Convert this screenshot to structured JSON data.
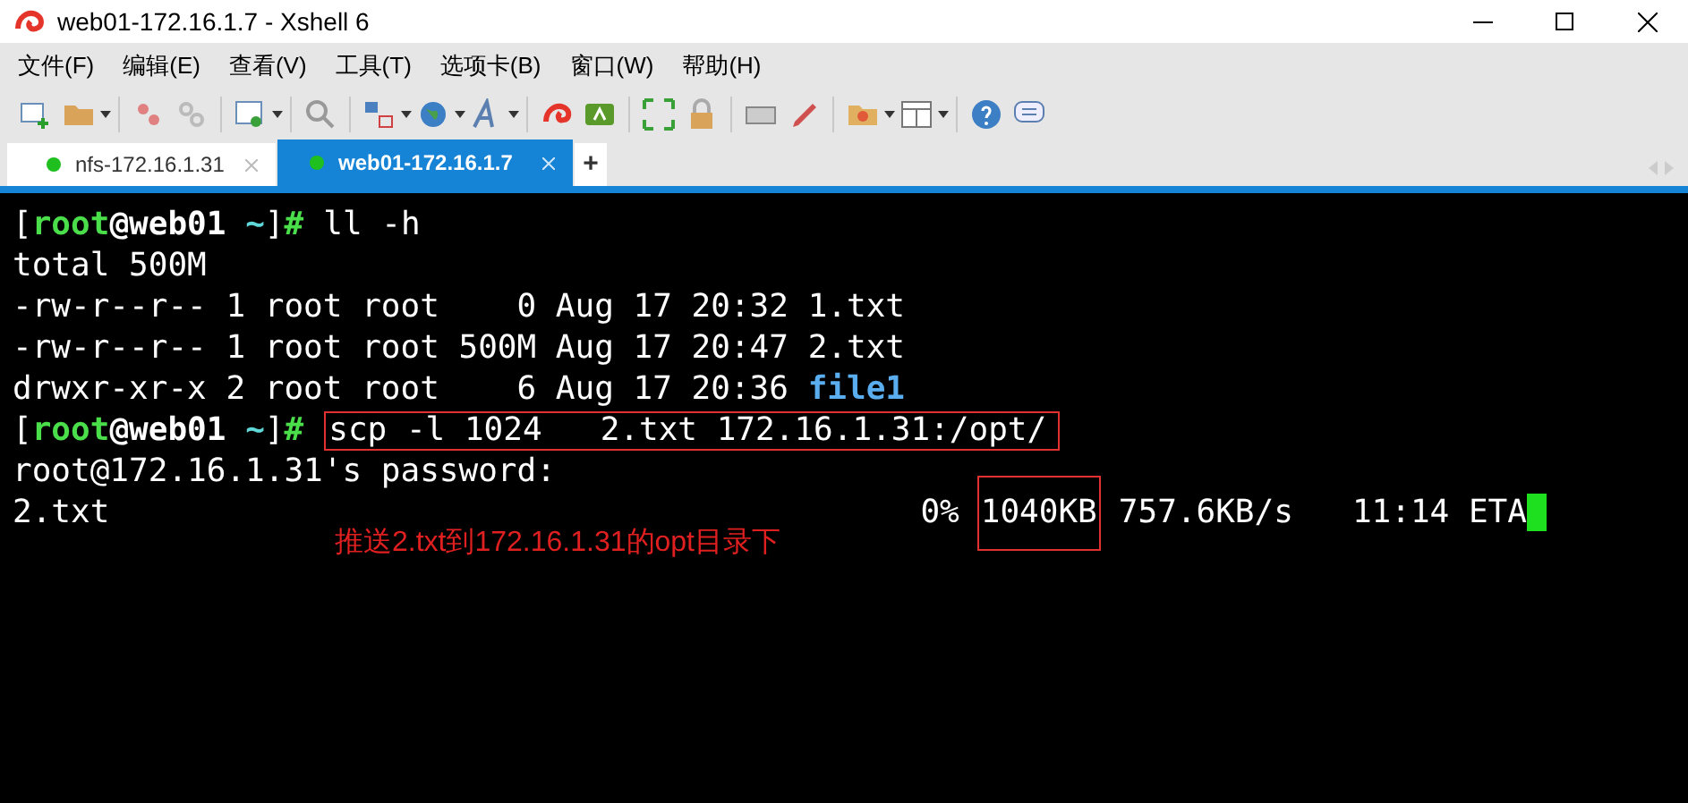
{
  "window": {
    "title": "web01-172.16.1.7 - Xshell 6"
  },
  "menu": [
    "文件(F)",
    "编辑(E)",
    "查看(V)",
    "工具(T)",
    "选项卡(B)",
    "窗口(W)",
    "帮助(H)"
  ],
  "tabs": [
    {
      "label": "nfs-172.16.1.31",
      "selected": false
    },
    {
      "label": "web01-172.16.1.7",
      "selected": true
    }
  ],
  "new_tab": "+",
  "terminal": {
    "lines": [
      {
        "kind": "prompt",
        "parts": [
          {
            "text": "[",
            "kind": "bracket"
          },
          {
            "text": "root",
            "kind": "user"
          },
          {
            "text": "@web01",
            "kind": "host"
          },
          {
            "text": " ~",
            "kind": "dir"
          },
          {
            "text": "]",
            "kind": "bracket"
          },
          {
            "text": "#",
            "kind": "hash"
          }
        ],
        "command": "ll -h",
        "boxed": false
      },
      {
        "kind": "output",
        "parts": [
          {
            "text": "total 500M",
            "kind": "plain"
          }
        ]
      },
      {
        "kind": "output",
        "parts": [
          {
            "text": "-rw-r--r-- 1 root root    0 Aug 17 20:32 ",
            "kind": "plain"
          },
          {
            "text": "1.txt",
            "kind": "plain"
          }
        ]
      },
      {
        "kind": "output",
        "parts": [
          {
            "text": "-rw-r--r-- 1 root root 500M Aug 17 20:47 ",
            "kind": "plain"
          },
          {
            "text": "2.txt",
            "kind": "plain"
          }
        ]
      },
      {
        "kind": "output",
        "parts": [
          {
            "text": "drwxr-xr-x 2 root root    6 Aug 17 20:36 ",
            "kind": "plain"
          },
          {
            "text": "file1",
            "kind": "directory"
          }
        ]
      },
      {
        "kind": "prompt",
        "parts": [
          {
            "text": "[",
            "kind": "bracket"
          },
          {
            "text": "root",
            "kind": "user"
          },
          {
            "text": "@web01",
            "kind": "host"
          },
          {
            "text": " ~",
            "kind": "dir"
          },
          {
            "text": "]",
            "kind": "bracket"
          },
          {
            "text": "#",
            "kind": "hash"
          }
        ],
        "command": "scp -l 1024   2.txt 172.16.1.31:/opt/",
        "boxed": true
      },
      {
        "kind": "output",
        "parts": [
          {
            "text": "root@172.16.1.31's password:",
            "kind": "plain"
          }
        ]
      },
      {
        "kind": "progress",
        "file": "2.txt",
        "percent": "0%",
        "transferred": "1040KB",
        "transferred_boxed": true,
        "rate": "757.6KB/s",
        "eta": "11:14 ETA"
      }
    ],
    "annotation": "推送2.txt到172.16.1.31的opt目录下"
  }
}
